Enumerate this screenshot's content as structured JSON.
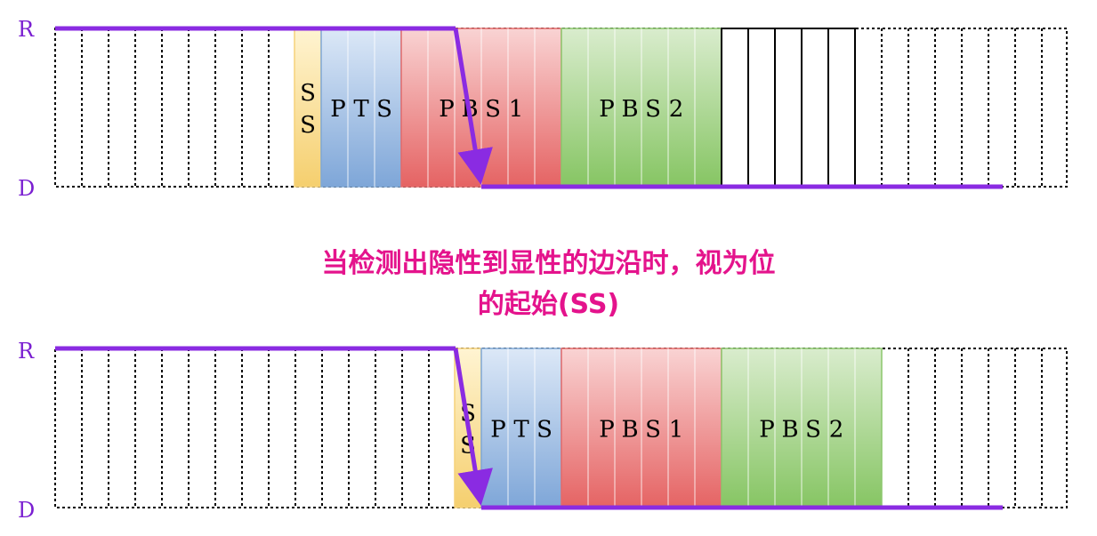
{
  "colors": {
    "signal": "#8a2be2",
    "label": "#7a1fd1",
    "caption": "#e4138c",
    "ss_fill": "#f6d27a",
    "pts_fill": "#7fa7d6",
    "pbs1_fill": "#e46b6b",
    "pbs2_fill": "#8cc76d"
  },
  "levels": {
    "recessive": "R",
    "dominant": "D"
  },
  "caption": {
    "line1": "当检测出隐性到显性的边沿时，视为位",
    "line2": "的起始(SS)"
  },
  "diagrams": [
    {
      "id": "before",
      "segments": [
        {
          "key": "ss",
          "label": [
            "S",
            "S"
          ],
          "slots": 1
        },
        {
          "key": "pts",
          "label": [
            "P",
            "T",
            "S"
          ],
          "slots": 3
        },
        {
          "key": "pbs1",
          "label": [
            "P",
            "B",
            "S",
            "1"
          ],
          "slots": 6
        },
        {
          "key": "pbs2",
          "label": [
            "P",
            "B",
            "S",
            "2"
          ],
          "slots": 6
        }
      ],
      "solid_tail_slots": 5
    },
    {
      "id": "after",
      "segments": [
        {
          "key": "ss",
          "label": [
            "S",
            "S"
          ],
          "slots": 1
        },
        {
          "key": "pts",
          "label": [
            "P",
            "T",
            "S"
          ],
          "slots": 3
        },
        {
          "key": "pbs1",
          "label": [
            "P",
            "B",
            "S",
            "1"
          ],
          "slots": 6
        },
        {
          "key": "pbs2",
          "label": [
            "P",
            "B",
            "S",
            "2"
          ],
          "slots": 6
        }
      ],
      "solid_tail_slots": 0
    }
  ]
}
